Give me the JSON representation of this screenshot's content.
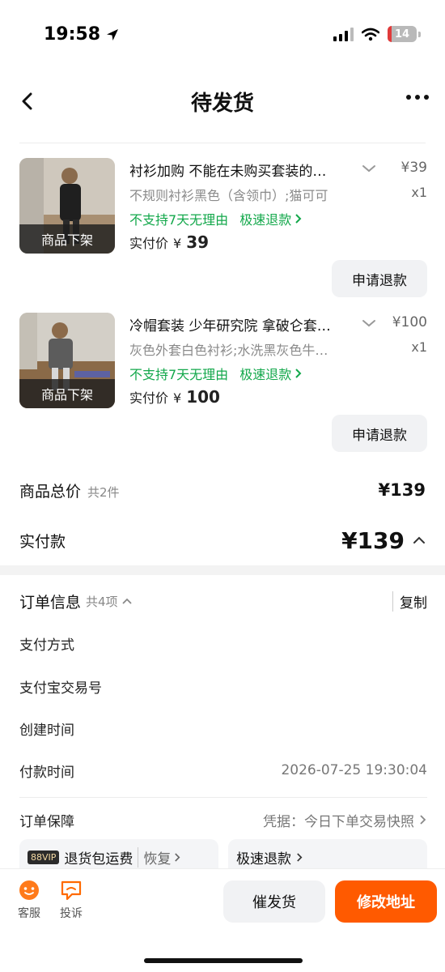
{
  "status_bar": {
    "time": "19:58",
    "battery": "14",
    "battery_level": 0.14
  },
  "nav": {
    "title": "待发货"
  },
  "products": [
    {
      "thumb_label": "商品下架",
      "title": "衬衫加购 不能在未购买套装的…",
      "price": "¥39",
      "spec": "不规则衬衫黑色（含领巾）;猫可可",
      "qty": "x1",
      "tag_no_return": "不支持7天无理由",
      "tag_fast_refund": "极速退款",
      "paid_label": "实付价",
      "paid_currency": "¥",
      "paid_amount": "39",
      "refund_button": "申请退款"
    },
    {
      "thumb_label": "商品下架",
      "title": "冷帽套装 少年研究院 拿破仑套…",
      "price": "¥100",
      "spec": "灰色外套白色衬衫;水洗黑灰色牛…",
      "qty": "x1",
      "tag_no_return": "不支持7天无理由",
      "tag_fast_refund": "极速退款",
      "paid_label": "实付价",
      "paid_currency": "¥",
      "paid_amount": "100",
      "refund_button": "申请退款"
    }
  ],
  "totals": {
    "goods_total_label": "商品总价",
    "goods_count": "共2件",
    "goods_total_value": "¥139",
    "paid_label": "实付款",
    "paid_value": "¥139"
  },
  "order_info": {
    "title": "订单信息",
    "count": "共4项",
    "copy_button": "复制",
    "rows": [
      {
        "label": "支付方式",
        "value": ""
      },
      {
        "label": "支付宝交易号",
        "value": ""
      },
      {
        "label": "创建时间",
        "value": ""
      },
      {
        "label": "付款时间",
        "value": "2026-07-25 19:30:04"
      }
    ],
    "guarantee_label": "订单保障",
    "guarantee_value": "凭据：今日下单交易快照",
    "vip_badge": "88VIP",
    "service_return_shipping": "退货包运费",
    "service_restore": "恢复",
    "service_fast_refund": "极速退款"
  },
  "bottom_bar": {
    "service_label": "客服",
    "complaint_label": "投诉",
    "urge_button": "催发货",
    "modify_button": "修改地址"
  },
  "colors": {
    "accent": "#ff5a00",
    "green": "#13a84b",
    "battery_low": "#e03a3a"
  }
}
